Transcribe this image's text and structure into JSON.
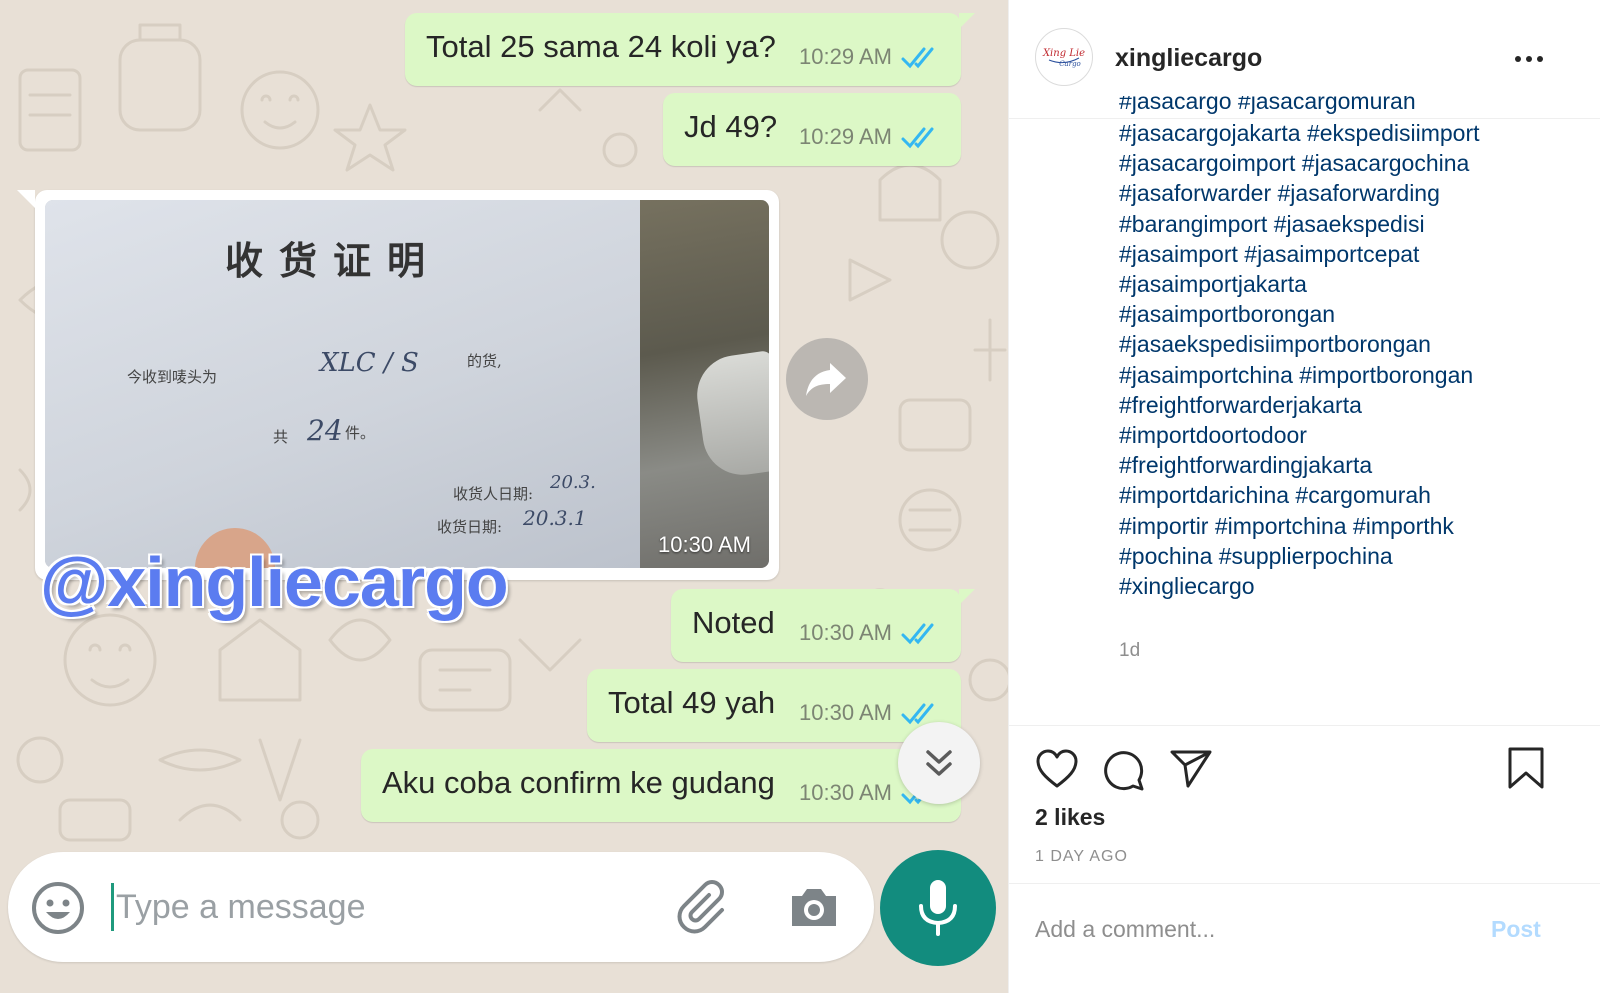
{
  "chat": {
    "messages": [
      {
        "text": "Total 25 sama 24 koli ya?",
        "time": "10:29 AM"
      },
      {
        "text": "Jd 49?",
        "time": "10:29 AM"
      },
      {
        "text": "Noted",
        "time": "10:30 AM"
      },
      {
        "text": "Total 49 yah",
        "time": "10:30 AM"
      },
      {
        "text": "Aku coba confirm ke gudang",
        "time": "10:30 AM"
      }
    ],
    "image_message": {
      "time": "10:30 AM",
      "document": {
        "title": "收货证明",
        "line1_label": "今收到唛头为",
        "line1_mark": "XLC / S",
        "line1_suffix": "的货,",
        "count_prefix": "共",
        "count_value": "24",
        "count_suffix": "件。",
        "receiver_date_label": "收货人日期:",
        "receiver_date_value": "20.3.",
        "receive_date_label": "收货日期:",
        "receive_date_value": "20.3.1"
      }
    },
    "watermark": "@xingliecargo",
    "input_placeholder": "Type a message",
    "colors": {
      "bubble": "#dcf8c6",
      "tick_read": "#34b7f1",
      "mic_button": "#128c7e"
    },
    "icons": [
      "forward-icon",
      "double-chevron-down-icon",
      "emoji-icon",
      "paperclip-icon",
      "camera-icon",
      "mic-icon"
    ]
  },
  "instagram": {
    "username": "xingliecargo",
    "avatar_text": "Xing Lie Cargo",
    "caption_cut_line": "#jasacargo #jasacargomurah",
    "caption_lines": [
      "#jasacargojakarta #ekspedisiimport",
      "#jasacargoimport #jasacargochina",
      "#jasaforwarder #jasaforwarding",
      "#barangimport #jasaekspedisi",
      "#jasaimport #jasaimportcepat",
      "#jasaimportjakarta",
      "#jasaimportborongan",
      "#jasaekspedisiimportborongan",
      "#jasaimportchina #importborongan",
      "#freightforwarderjakarta",
      "#importdoortodoor",
      "#freightforwardingjakarta",
      "#importdarichina #cargomurah",
      "#importir #importchina #importhk",
      "#pochina #supplierpochina",
      "#xingliecargo"
    ],
    "post_age": "1d",
    "likes": "2 likes",
    "date": "1 DAY AGO",
    "comment_placeholder": "Add a comment...",
    "post_button": "Post",
    "colors": {
      "hashtag": "#00376b",
      "post_button": "#b3dbff"
    }
  }
}
